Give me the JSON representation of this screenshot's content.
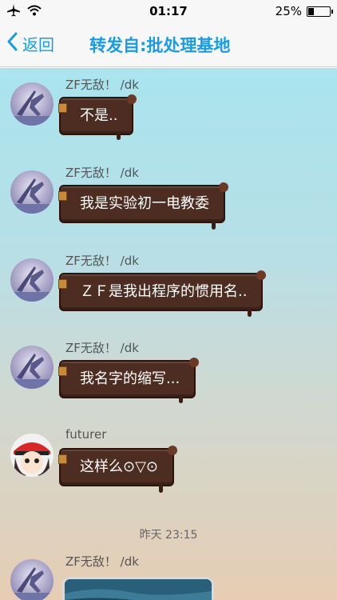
{
  "status_bar": {
    "time": "01:17",
    "battery": "25%",
    "battery_level": 0.25,
    "airplane_icon": "airplane-icon",
    "wifi_icon": "wifi-icon"
  },
  "nav": {
    "back_label": "返回",
    "title": "转发自:批处理基地"
  },
  "messages": [
    {
      "sender": "ZF无敌！ /dk",
      "text": "不是..",
      "avatar": "avatar-zf"
    },
    {
      "sender": "ZF无敌！ /dk",
      "text": "我是实验初一电教委",
      "avatar": "avatar-zf"
    },
    {
      "sender": "ZF无敌！ /dk",
      "text": "ＺＦ是我出程序的惯用名..",
      "avatar": "avatar-zf"
    },
    {
      "sender": "ZF无敌！ /dk",
      "text": "我名字的缩写...",
      "avatar": "avatar-zf"
    },
    {
      "sender": "futurer",
      "text": "这样么⊙▽⊙",
      "avatar": "avatar-futurer"
    },
    {
      "sender": "ZF无敌！ /dk",
      "text": "",
      "avatar": "avatar-zf"
    }
  ],
  "timestamp": "昨天 23:15",
  "colors": {
    "accent": "#1a9be6",
    "bubble": "#4d2d22",
    "bubble_text": "#ffffff"
  }
}
